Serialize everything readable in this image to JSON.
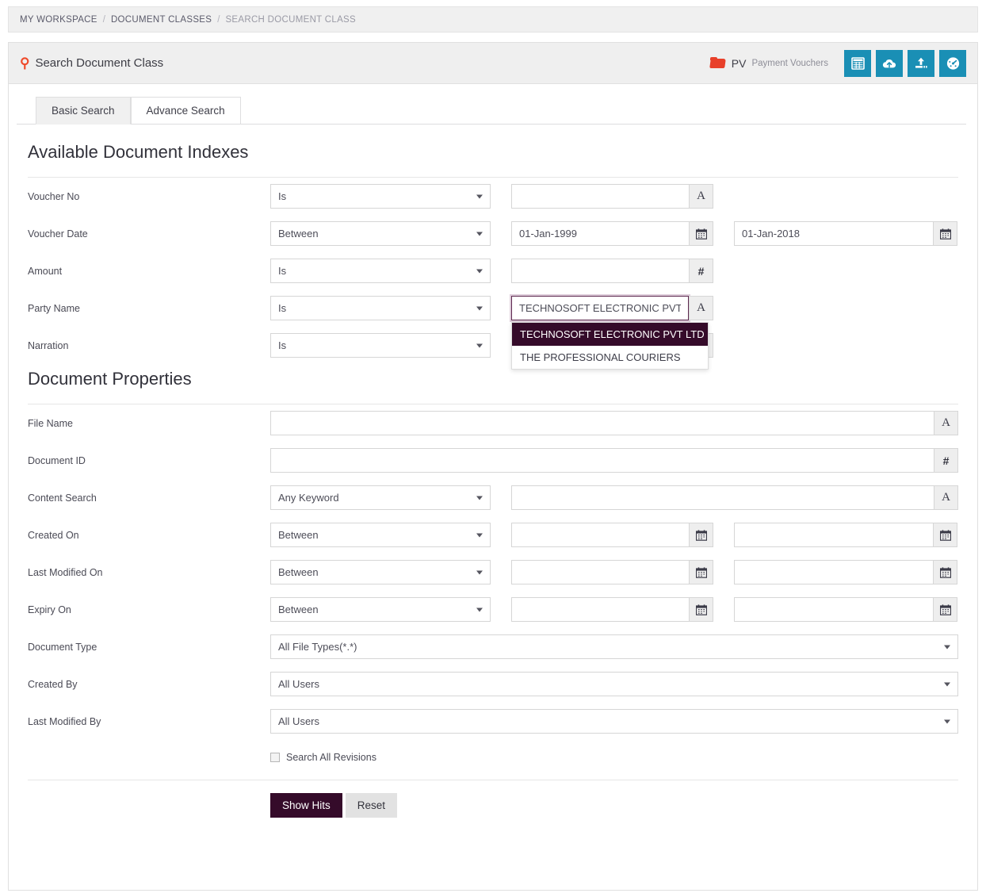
{
  "breadcrumb": {
    "items": [
      {
        "label": "MY WORKSPACE",
        "active": false
      },
      {
        "label": "DOCUMENT CLASSES",
        "active": false
      },
      {
        "label": "SEARCH DOCUMENT CLASS",
        "active": true
      }
    ],
    "separator": "/"
  },
  "header": {
    "title": "Search Document Class",
    "search_icon": "search-icon",
    "class_abbr": "PV",
    "class_name": "Payment Vouchers",
    "folder_icon": "folder-icon",
    "accent_color": "#1a8fb5",
    "brand_color": "#350b2a",
    "icon_red": "#e8402a",
    "tools": [
      {
        "name": "grid-icon",
        "title": "Grid View"
      },
      {
        "name": "cloud-upload-icon",
        "title": "Cloud Upload"
      },
      {
        "name": "upload-icon",
        "title": "Upload"
      },
      {
        "name": "dashboard-icon",
        "title": "Dashboard"
      }
    ]
  },
  "tabs": [
    {
      "label": "Basic Search",
      "active": true
    },
    {
      "label": "Advance Search",
      "active": false
    }
  ],
  "sections": {
    "indexes_title": "Available Document Indexes",
    "properties_title": "Document Properties"
  },
  "indexes": [
    {
      "label": "Voucher No",
      "operator": "Is",
      "value": "",
      "addon": "A"
    },
    {
      "label": "Voucher Date",
      "operator": "Between",
      "value": "01-Jan-1999",
      "value2": "01-Jan-2018",
      "addon": "calendar",
      "addon2": "calendar"
    },
    {
      "label": "Amount",
      "operator": "Is",
      "value": "",
      "addon": "#"
    },
    {
      "label": "Party Name",
      "operator": "Is",
      "value": "TECHNOSOFT ELECTRONIC PVT LTD",
      "addon": "A",
      "focused": true
    },
    {
      "label": "Narration",
      "operator": "Is",
      "value": "",
      "addon": "A"
    }
  ],
  "autocomplete": {
    "open": true,
    "options": [
      {
        "label": "TECHNOSOFT ELECTRONIC PVT LTD",
        "selected": true
      },
      {
        "label": "THE PROFESSIONAL COURIERS",
        "selected": false
      }
    ],
    "highlight_color": "#350b2a"
  },
  "properties": {
    "file_name": {
      "label": "File Name",
      "value": "",
      "addon": "A"
    },
    "document_id": {
      "label": "Document ID",
      "value": "",
      "addon": "#"
    },
    "content_search": {
      "label": "Content Search",
      "operator": "Any Keyword",
      "value": "",
      "addon": "A"
    },
    "created_on": {
      "label": "Created On",
      "operator": "Between",
      "value": "",
      "value2": ""
    },
    "last_modified_on": {
      "label": "Last Modified On",
      "operator": "Between",
      "value": "",
      "value2": ""
    },
    "expiry_on": {
      "label": "Expiry On",
      "operator": "Between",
      "value": "",
      "value2": ""
    },
    "document_type": {
      "label": "Document Type",
      "value": "All File Types(*.*)"
    },
    "created_by": {
      "label": "Created By",
      "value": "All Users"
    },
    "last_modified_by": {
      "label": "Last Modified By",
      "value": "All Users"
    }
  },
  "options": {
    "search_all_revisions": {
      "label": "Search All Revisions",
      "checked": false
    }
  },
  "actions": {
    "submit": "Show Hits",
    "reset": "Reset"
  }
}
